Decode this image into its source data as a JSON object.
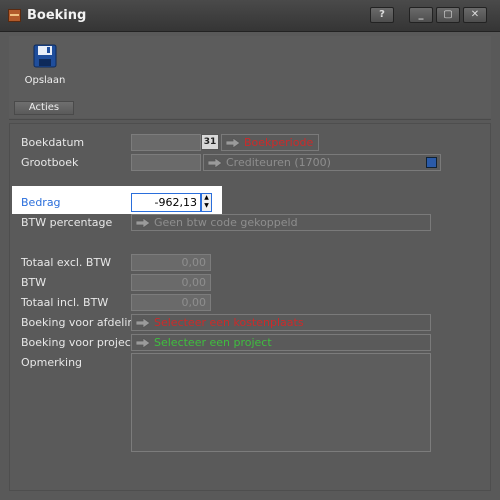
{
  "window": {
    "title": "Boeking",
    "help": "?",
    "minimize": "_",
    "maximize": "▢",
    "close": "✕"
  },
  "toolbar": {
    "save_label": "Opslaan",
    "group_label": "Acties"
  },
  "form": {
    "boekdatum": {
      "label": "Boekdatum",
      "value": "",
      "calendar_text": "31",
      "period_link": "Boekperiode",
      "period_color": "#cc2a2a"
    },
    "grootboek": {
      "label": "Grootboek",
      "value": "",
      "account": "Crediteuren (1700)"
    },
    "bedrag": {
      "label": "Bedrag",
      "value": "-962,13",
      "label_color": "#2a6edb"
    },
    "btw_percentage": {
      "label": "BTW percentage",
      "value": "Geen btw code gekoppeld"
    },
    "totaal_excl": {
      "label": "Totaal excl. BTW",
      "value": "0,00"
    },
    "btw": {
      "label": "BTW",
      "value": "0,00"
    },
    "totaal_incl": {
      "label": "Totaal incl. BTW",
      "value": "0,00"
    },
    "afdeling": {
      "label": "Boeking voor afdeling",
      "link": "Selecteer een kostenplaats",
      "color": "#cc2a2a"
    },
    "project": {
      "label": "Boeking voor project",
      "link": "Selecteer een project",
      "color": "#2a8a2a"
    },
    "opmerking": {
      "label": "Opmerking",
      "value": ""
    }
  }
}
